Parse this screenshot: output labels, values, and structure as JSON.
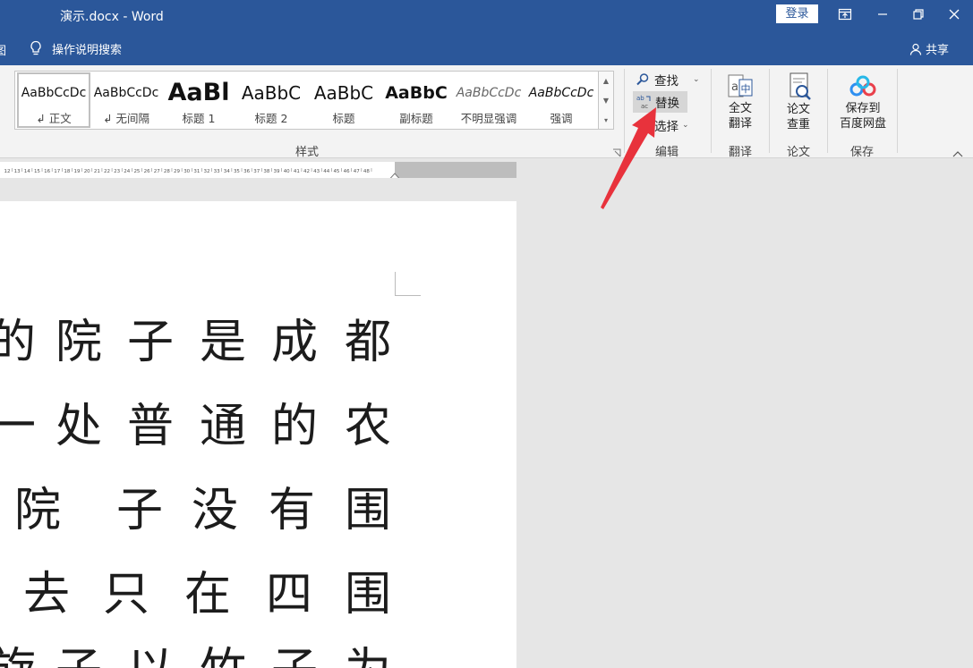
{
  "window": {
    "title": "演示.docx  -  Word",
    "login_label": "登录",
    "icons": [
      "ribbon-display-icon",
      "minimize-icon",
      "restore-icon",
      "close-icon"
    ]
  },
  "command_bar": {
    "left_fragment": "图",
    "tell_me": "操作说明搜索",
    "share": "共享"
  },
  "styles": {
    "items": [
      {
        "preview": "AaBbCcDc",
        "name": "↲ 正文"
      },
      {
        "preview": "AaBbCcDc",
        "name": "↲ 无间隔"
      },
      {
        "preview": "AaBl",
        "name": "标题 1"
      },
      {
        "preview": "AaBbC",
        "name": "标题 2"
      },
      {
        "preview": "AaBbC",
        "name": "标题"
      },
      {
        "preview": "AaBbC",
        "name": "副标题"
      },
      {
        "preview": "AaBbCcDc",
        "name": "不明显强调"
      },
      {
        "preview": "AaBbCcDc",
        "name": "强调"
      }
    ],
    "group_label": "样式"
  },
  "editing": {
    "find": "查找",
    "replace": "替换",
    "select": "选择",
    "group_label": "编辑"
  },
  "translate": {
    "button": [
      "全文",
      "翻译"
    ],
    "group_label": "翻译"
  },
  "paper": {
    "button": [
      "论文",
      "查重"
    ],
    "group_label": "论文"
  },
  "save": {
    "button": [
      "保存到",
      "百度网盘"
    ],
    "group_label": "保存"
  },
  "ruler": {
    "start": 12,
    "end": 48
  },
  "document": {
    "lines": [
      [
        "的",
        "院",
        "子",
        "是",
        "成",
        "都"
      ],
      [
        "一",
        "处",
        "普",
        "通",
        "的",
        "农"
      ],
      [
        "院",
        "子",
        "没",
        "有",
        "围"
      ],
      [
        "去",
        "只",
        "在",
        "四",
        "围"
      ],
      [
        "旋",
        "子",
        "以",
        "竹",
        "子",
        "为"
      ]
    ]
  },
  "colors": {
    "title_bar": "#2b579a",
    "ribbon": "#f3f3f3",
    "annotation_arrow": "#e8323c"
  }
}
